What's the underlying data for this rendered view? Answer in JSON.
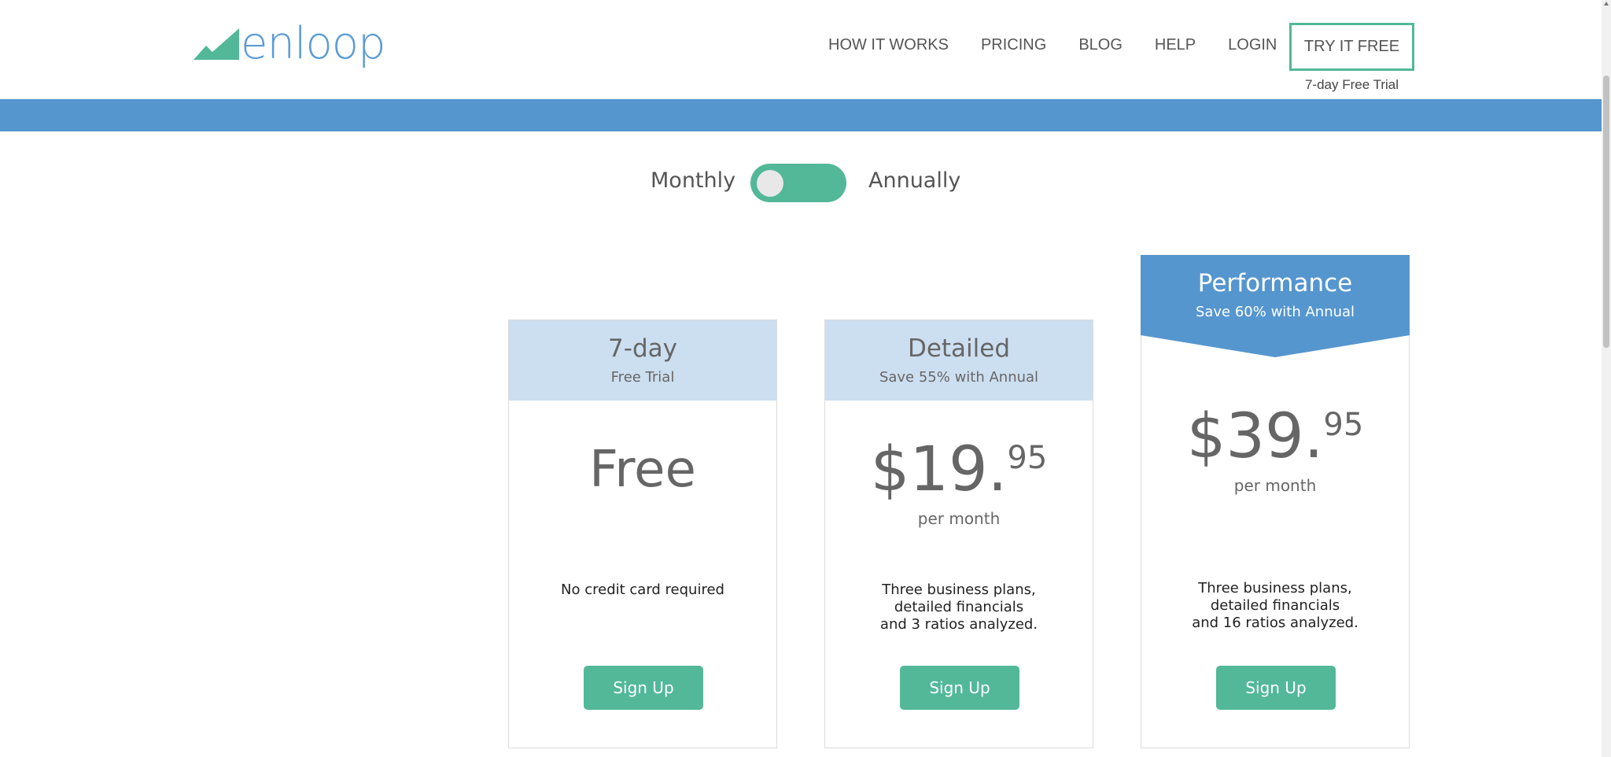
{
  "brand": {
    "name": "enloop",
    "color": "#5b9bd5",
    "mark_color": "#52b898"
  },
  "nav": {
    "items": [
      {
        "label": "HOW IT WORKS"
      },
      {
        "label": "PRICING"
      },
      {
        "label": "BLOG"
      },
      {
        "label": "HELP"
      },
      {
        "label": "LOGIN"
      }
    ],
    "cta_label": "TRY IT FREE",
    "cta_note": "7-day Free Trial"
  },
  "billing": {
    "monthly_label": "Monthly",
    "annually_label": "Annually",
    "selected": "Monthly"
  },
  "colors": {
    "accent": "#52b898",
    "band": "#5596cf",
    "card_head": "#ccdff0",
    "featured_head": "#5596cf"
  },
  "plans": [
    {
      "name": "7-day",
      "subtitle": "Free Trial",
      "price": "Free",
      "features": [
        "No credit card required"
      ],
      "button": "Sign Up"
    },
    {
      "name": "Detailed",
      "subtitle": "Save 55% with Annual",
      "price_dollars": "$19.",
      "price_cents": "95",
      "period": "per month",
      "features": [
        "Three business plans,",
        "detailed financials",
        "and 3 ratios analyzed."
      ],
      "button": "Sign Up"
    },
    {
      "name": "Performance",
      "subtitle": "Save 60% with Annual",
      "price_dollars": "$39.",
      "price_cents": "95",
      "period": "per month",
      "features": [
        "Three business plans,",
        "detailed financials",
        "and 16 ratios analyzed."
      ],
      "button": "Sign Up"
    }
  ]
}
